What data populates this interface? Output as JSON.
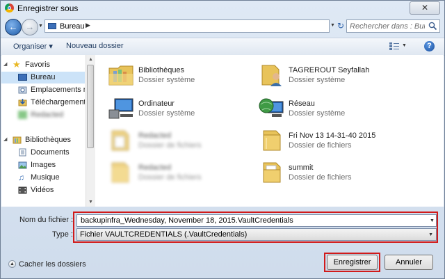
{
  "window": {
    "title": "Enregistrer sous",
    "close_glyph": "✕"
  },
  "address": {
    "location": "Bureau",
    "search_placeholder": "Rechercher dans : Bureau"
  },
  "toolbar": {
    "organize_label": "Organiser",
    "new_folder_label": "Nouveau dossier",
    "help_glyph": "?"
  },
  "nav": {
    "favorites": "Favoris",
    "desktop": "Bureau",
    "recent_places": "Emplacements réc",
    "downloads": "Téléchargements",
    "blurred_item": "Redacted",
    "libraries": "Bibliothèques",
    "documents": "Documents",
    "images": "Images",
    "music": "Musique",
    "videos": "Vidéos"
  },
  "files": [
    {
      "name": "Bibliothèques",
      "type": "Dossier système",
      "icon": "libraries-folder-icon",
      "blurred": false
    },
    {
      "name": "TAGREROUT Seyfallah",
      "type": "Dossier système",
      "icon": "user-folder-icon",
      "blurred": false
    },
    {
      "name": "Ordinateur",
      "type": "Dossier système",
      "icon": "computer-icon",
      "blurred": false
    },
    {
      "name": "Réseau",
      "type": "Dossier système",
      "icon": "network-icon",
      "blurred": false
    },
    {
      "name": "Redacted",
      "type": "Dossier de fichiers",
      "icon": "folder-icon",
      "blurred": true
    },
    {
      "name": "Fri Nov 13 14-31-40 2015",
      "type": "Dossier de fichiers",
      "icon": "folder-icon",
      "blurred": false
    },
    {
      "name": "Redacted",
      "type": "Dossier de fichiers",
      "icon": "folder-icon",
      "blurred": true
    },
    {
      "name": "summit",
      "type": "Dossier de fichiers",
      "icon": "folder-icon",
      "blurred": false
    }
  ],
  "form": {
    "filename_label": "Nom du fichier :",
    "filename_value": "backupinfra_Wednesday, November 18, 2015.VaultCredentials",
    "type_label": "Type :",
    "type_value": "Fichier VAULTCREDENTIALS (.VaultCredentials)"
  },
  "footer": {
    "hide_folders": "Cacher les dossiers",
    "save_label": "Enregistrer",
    "cancel_label": "Annuler"
  },
  "colors": {
    "accent": "#1f5ca8",
    "selection": "#cce3f8",
    "highlight": "#d11a1a",
    "folder": "#e8c35a"
  }
}
